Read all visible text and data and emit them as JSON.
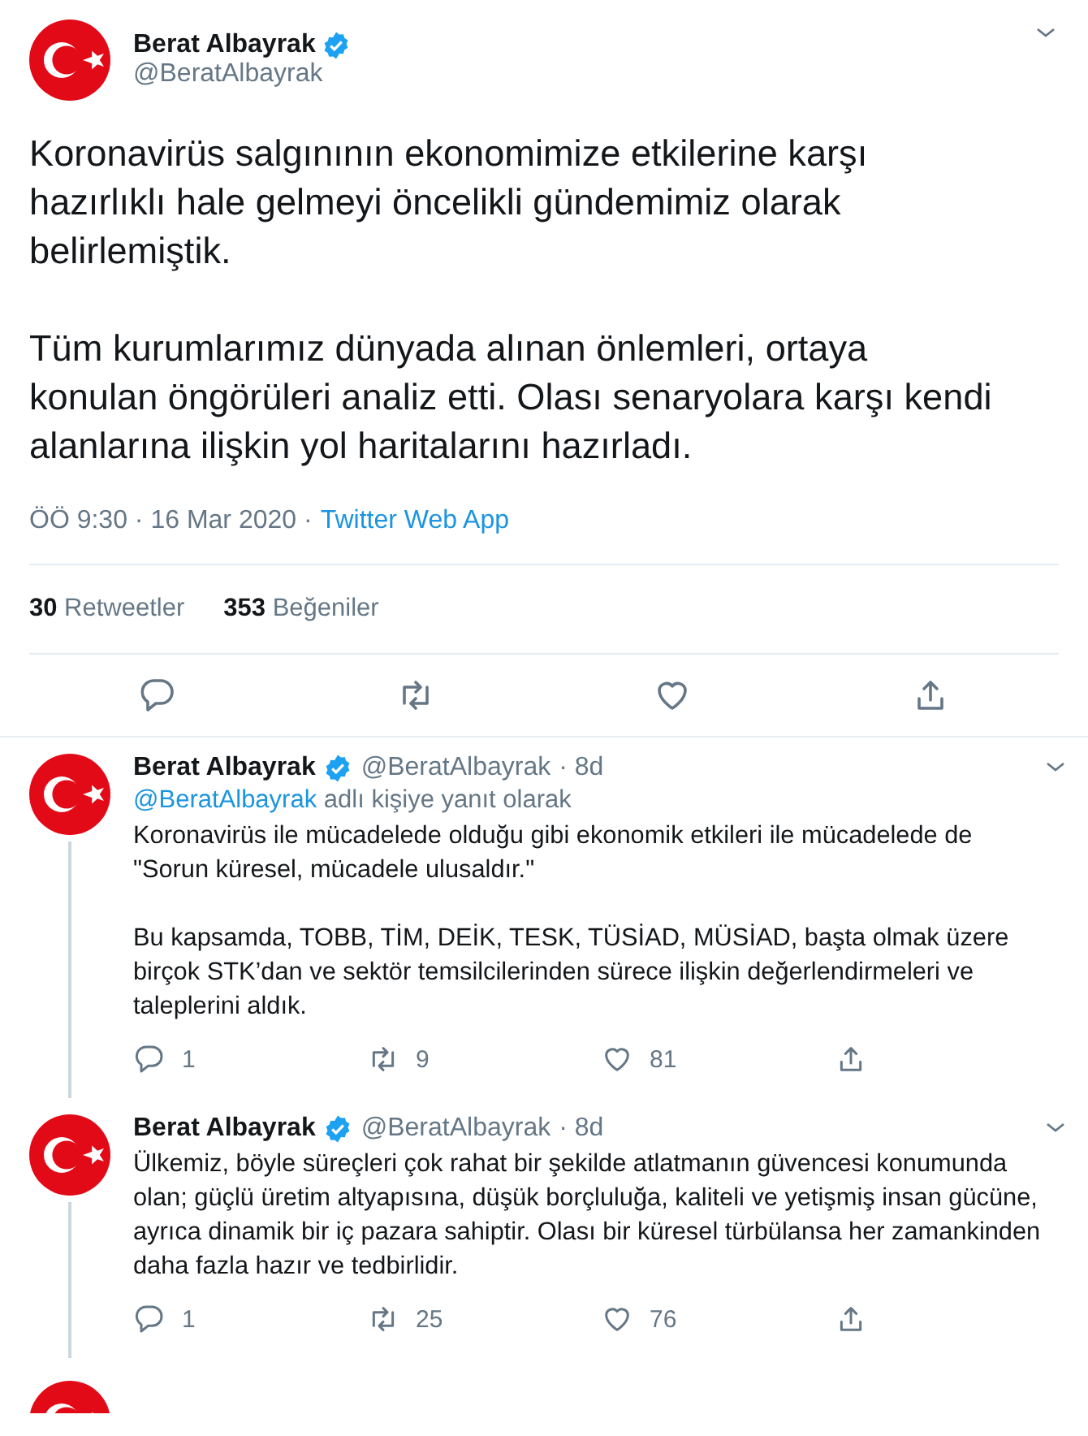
{
  "main_tweet": {
    "author": {
      "name": "Berat Albayrak",
      "verified": true,
      "handle": "@BeratAlbayrak"
    },
    "paragraphs": [
      "Koronavirüs salgınının ekonomimize etkilerine karşı hazırlıklı hale gelmeyi öncelikli gündemimiz olarak belirlemiştik.",
      "Tüm kurumlarımız dünyada alınan önlemleri, ortaya konulan öngörüleri analiz etti. Olası senaryolara karşı kendi alanlarına ilişkin yol haritalarını hazırladı."
    ],
    "timestamp": "ÖÖ 9:30 · 16 Mar 2020 ·",
    "source": "Twitter Web App",
    "stats": [
      {
        "count": "30",
        "label": "Retweetler"
      },
      {
        "count": "353",
        "label": "Beğeniler"
      }
    ]
  },
  "replies": [
    {
      "author": {
        "name": "Berat Albayrak",
        "verified": true,
        "handle": "@BeratAlbayrak",
        "time": "· 8d"
      },
      "reply_to": {
        "handle": "@BeratAlbayrak",
        "text": "adlı kişiye yanıt olarak"
      },
      "paragraphs": [
        "Koronavirüs ile mücadelede olduğu gibi ekonomik etkileri ile mücadelede de \"Sorun küresel, mücadele ulusaldır.\"",
        "Bu kapsamda, TOBB, TİM, DEİK, TESK, TÜSİAD, MÜSİAD, başta olmak üzere birçok STK’dan ve sektör temsilcilerinden sürece ilişkin değerlendirmeleri ve taleplerini aldık."
      ],
      "replies": "1",
      "retweets": "9",
      "likes": "81"
    },
    {
      "author": {
        "name": "Berat Albayrak",
        "verified": true,
        "handle": "@BeratAlbayrak",
        "time": "· 8d"
      },
      "paragraphs": [
        "Ülkemiz, böyle süreçleri çok rahat bir şekilde atlatmanın güvencesi konumunda olan; güçlü üretim altyapısına, düşük borçluluğa, kaliteli ve yetişmiş insan gücüne, ayrıca dinamik bir iç pazara sahiptir. Olası bir küresel türbülansa her zamankinden daha fazla hazır ve tedbirlidir."
      ],
      "replies": "1",
      "retweets": "25",
      "likes": "76"
    }
  ]
}
